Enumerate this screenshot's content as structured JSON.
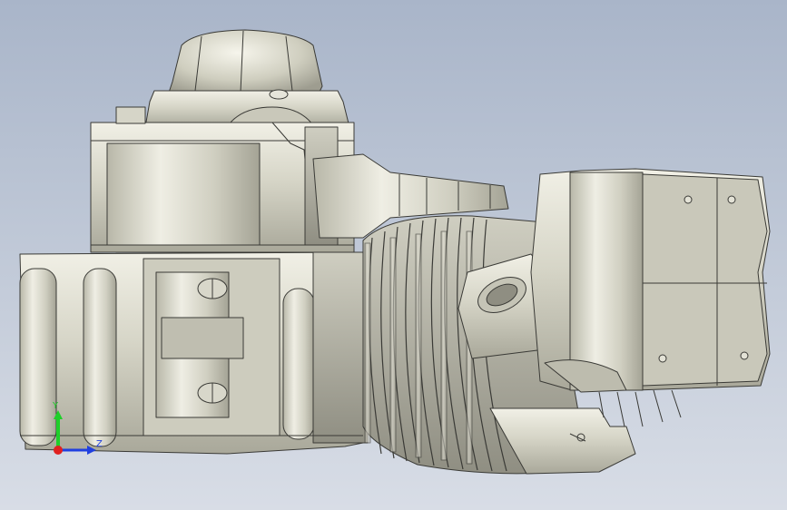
{
  "viewport": {
    "background_top": "#a9b5c9",
    "background_bottom": "#d8dde6"
  },
  "model": {
    "shaded_color": "#d9d8cc",
    "edge_color": "#3a3a36"
  },
  "triad": {
    "y_label": "Y",
    "z_label": "Z",
    "x_axis_color": "#e02020",
    "y_axis_color": "#1fcf2a",
    "z_axis_color": "#1f3fe0"
  }
}
